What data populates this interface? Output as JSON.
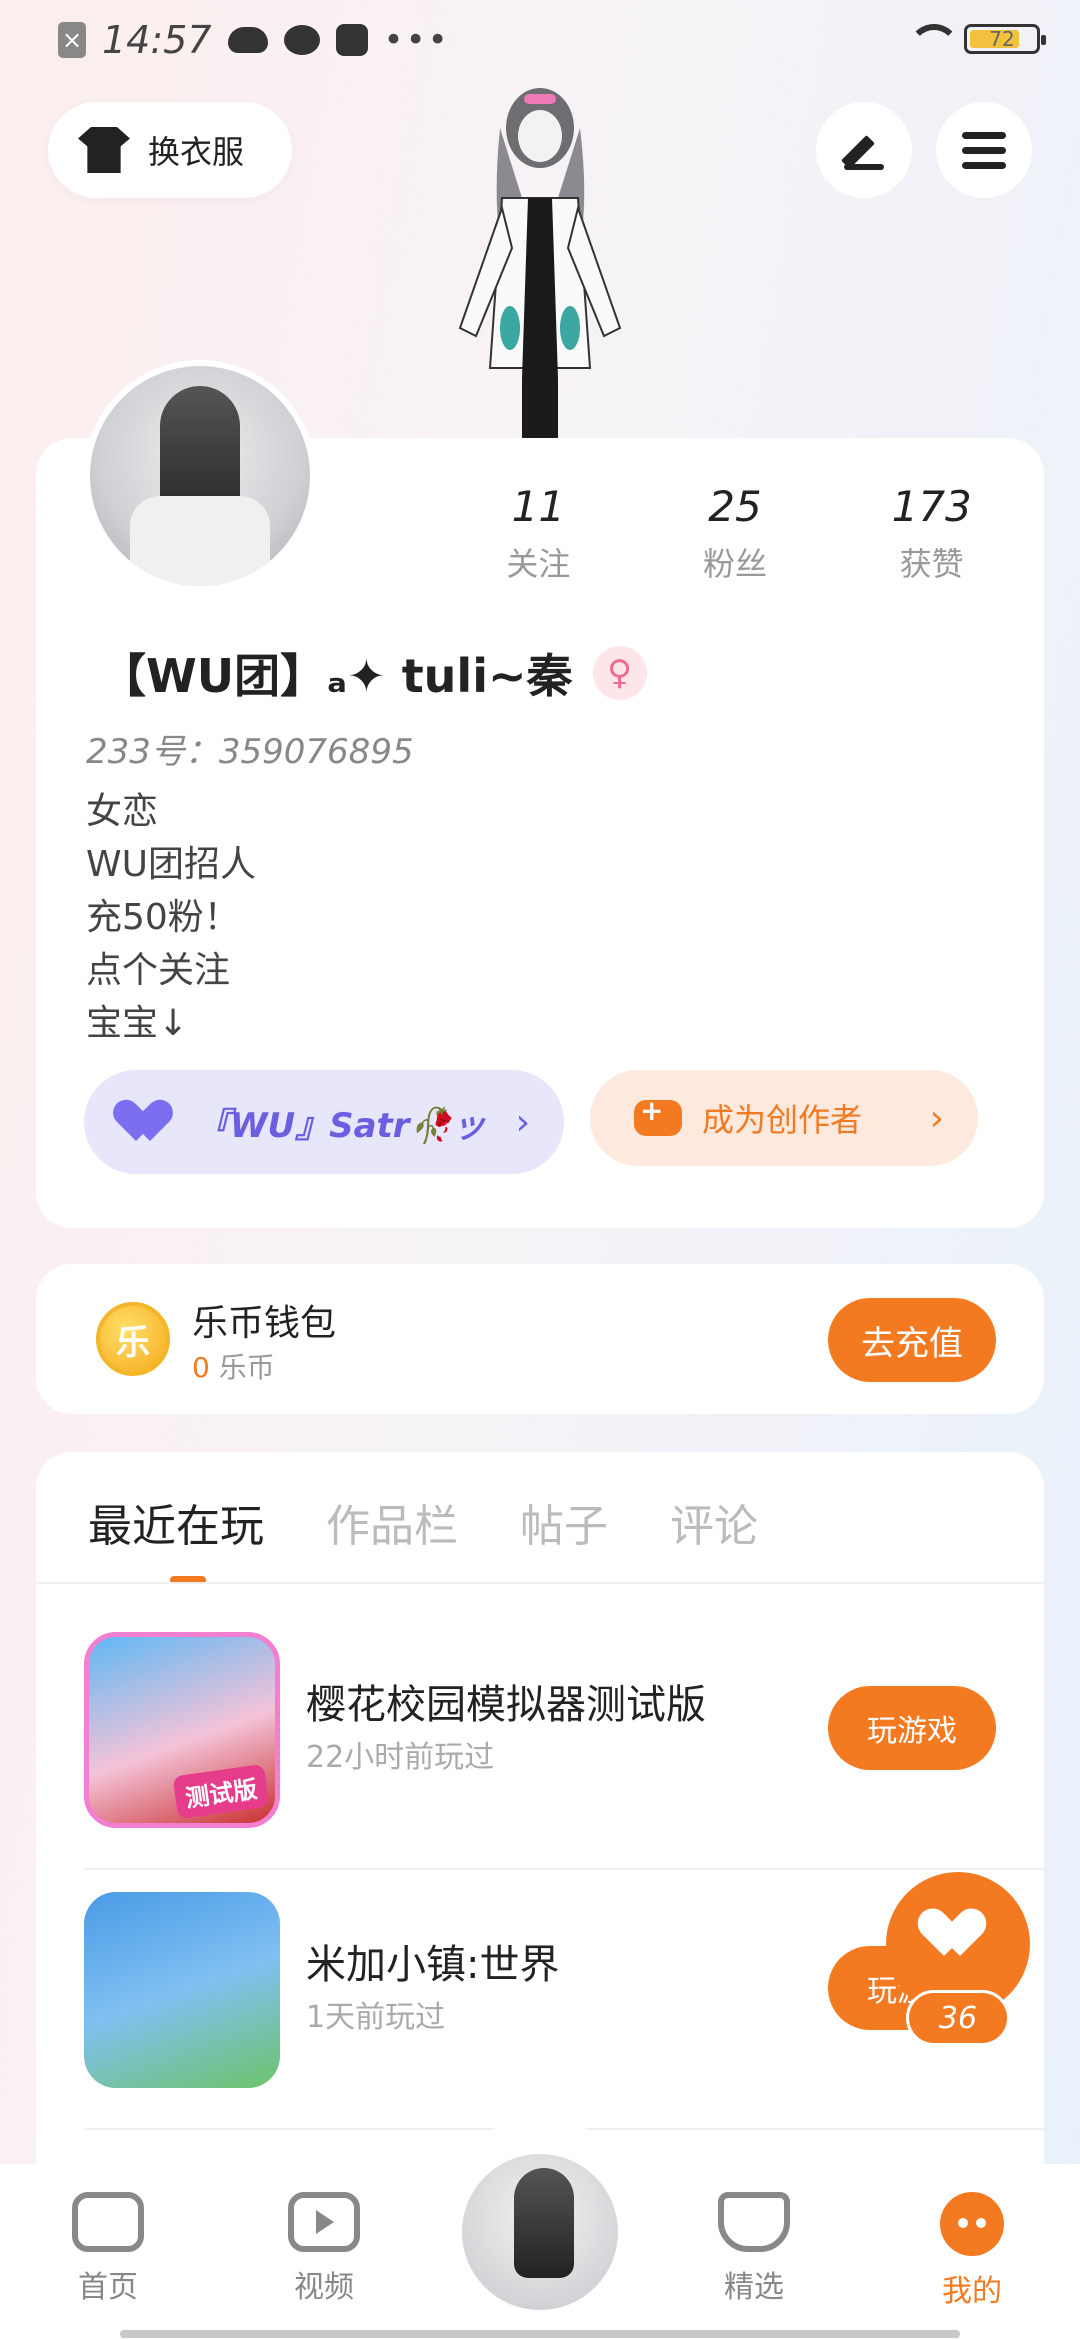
{
  "status_bar": {
    "time": "14:57",
    "close_icon_text": "×",
    "more": "•••",
    "battery": "72"
  },
  "top": {
    "outfit_label": "换衣服"
  },
  "profile": {
    "stats": [
      {
        "value": "11",
        "label": "关注"
      },
      {
        "value": "25",
        "label": "粉丝"
      },
      {
        "value": "173",
        "label": "获赞"
      }
    ],
    "nickname": "【WU团】ₐ✦ tuli~秦",
    "gender_symbol": "♀",
    "uid": "233号：359076895",
    "bio": [
      "女恋",
      "WU团招人",
      "充50粉！",
      "点个关注",
      "宝宝↓"
    ],
    "guild_label": "『WU』Satr🥀ッ",
    "creator_label": "成为创作者",
    "chevron": "›"
  },
  "wallet": {
    "coin_glyph": "乐",
    "title": "乐币钱包",
    "amount": "0",
    "unit": "乐币",
    "recharge_label": "去充值"
  },
  "tabs": [
    "最近在玩",
    "作品栏",
    "帖子",
    "评论"
  ],
  "games": [
    {
      "name": "樱花校园模拟器测试版",
      "time": "22小时前玩过",
      "badge": "测试版",
      "action": "玩游戏"
    },
    {
      "name": "米加小镇:世界",
      "time": "1天前玩过",
      "action": "玩游戏"
    }
  ],
  "floating_like": {
    "count": "36"
  },
  "bottom_nav": [
    {
      "label": "首页"
    },
    {
      "label": "视频"
    },
    {
      "label": "精选"
    },
    {
      "label": "我的"
    }
  ],
  "colors": {
    "accent": "#f47a22",
    "purple": "#6a5fe0",
    "text": "#222222",
    "muted": "#999999"
  }
}
